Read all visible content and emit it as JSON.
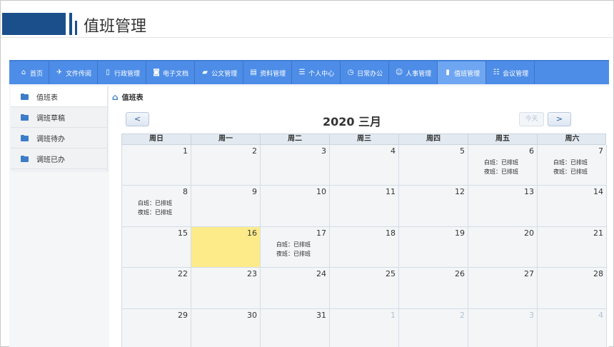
{
  "slide": {
    "title": "值班管理"
  },
  "nav": [
    {
      "icon": "home-icon",
      "glyph": "⌂",
      "label": "首页"
    },
    {
      "icon": "paper-plane-icon",
      "glyph": "✈",
      "label": "文件传阅"
    },
    {
      "icon": "bookmark-icon",
      "glyph": "▯",
      "label": "行政管理"
    },
    {
      "icon": "camera-icon",
      "glyph": "◙",
      "label": "电子文档"
    },
    {
      "icon": "folder-icon",
      "glyph": "▰",
      "label": "公文管理"
    },
    {
      "icon": "archive-icon",
      "glyph": "▤",
      "label": "资料管理"
    },
    {
      "icon": "user-card-icon",
      "glyph": "☰",
      "label": "个人中心"
    },
    {
      "icon": "clock-icon",
      "glyph": "◷",
      "label": "日常办公"
    },
    {
      "icon": "users-icon",
      "glyph": "☺",
      "label": "人事管理"
    },
    {
      "icon": "document-icon",
      "glyph": "▮",
      "label": "值班管理",
      "active": true
    },
    {
      "icon": "meeting-icon",
      "glyph": "☷",
      "label": "会议管理"
    }
  ],
  "sidebar": {
    "items": [
      {
        "label": "值班表",
        "active": true
      },
      {
        "label": "调班草稿"
      },
      {
        "label": "调班待办"
      },
      {
        "label": "调班已办"
      }
    ]
  },
  "breadcrumb": {
    "label": "值班表"
  },
  "calendar": {
    "title": "2020 三月",
    "prev_label": "<",
    "next_label": ">",
    "today_label": "今天",
    "weekdays": [
      "周日",
      "周一",
      "周二",
      "周三",
      "周四",
      "周五",
      "周六"
    ],
    "duty_day": "白班：已排班",
    "duty_night": "夜班：已排班",
    "days": [
      {
        "n": "1"
      },
      {
        "n": "2"
      },
      {
        "n": "3"
      },
      {
        "n": "4"
      },
      {
        "n": "5"
      },
      {
        "n": "6",
        "duty": true
      },
      {
        "n": "7",
        "duty": true
      },
      {
        "n": "8",
        "duty": true
      },
      {
        "n": "9"
      },
      {
        "n": "10"
      },
      {
        "n": "11"
      },
      {
        "n": "12"
      },
      {
        "n": "13"
      },
      {
        "n": "14"
      },
      {
        "n": "15"
      },
      {
        "n": "16",
        "today": true
      },
      {
        "n": "17",
        "duty": true
      },
      {
        "n": "18"
      },
      {
        "n": "19"
      },
      {
        "n": "20"
      },
      {
        "n": "21"
      },
      {
        "n": "22"
      },
      {
        "n": "23"
      },
      {
        "n": "24"
      },
      {
        "n": "25"
      },
      {
        "n": "26"
      },
      {
        "n": "27"
      },
      {
        "n": "28"
      },
      {
        "n": "29"
      },
      {
        "n": "30"
      },
      {
        "n": "31"
      },
      {
        "n": "1",
        "other": true
      },
      {
        "n": "2",
        "other": true
      },
      {
        "n": "3",
        "other": true
      },
      {
        "n": "4",
        "other": true
      }
    ]
  }
}
